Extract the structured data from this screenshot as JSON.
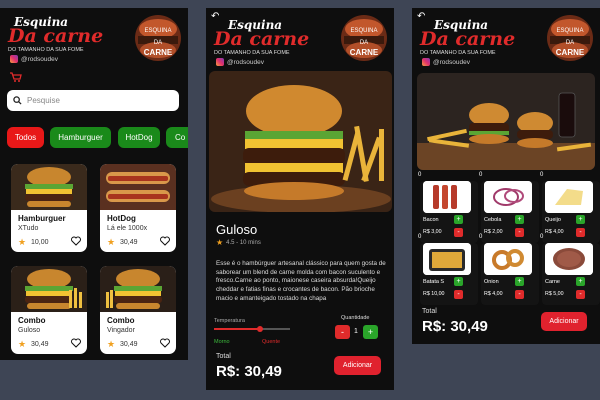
{
  "brand": {
    "top": "Esquina",
    "main": "Da carne",
    "tagline": "DO TAMANHO DA SUA FOME",
    "instagram": "@rodsoudev",
    "logo_line1": "ESQUINA",
    "logo_line2": "DA",
    "logo_line3": "CARNE"
  },
  "colors": {
    "accent": "#e0222e",
    "green": "#1e8a1e",
    "bg": "#0e0e0e"
  },
  "home": {
    "search_placeholder": "Pesquise",
    "categories": [
      "Todos",
      "Hamburguer",
      "HotDog",
      "Co"
    ],
    "products": [
      {
        "name": "Hamburguer",
        "sub": "XTudo",
        "price": "10,00"
      },
      {
        "name": "HotDog",
        "sub": "Lá ele 1000x",
        "price": "30,49"
      },
      {
        "name": "Combo",
        "sub": "Guloso",
        "price": "30,49"
      },
      {
        "name": "Combo",
        "sub": "Vingador",
        "price": "30,49"
      }
    ]
  },
  "detail": {
    "title": "Guloso",
    "rating": "4.5 - 10 mins",
    "description": "Esse é o hambúrguer artesanal clássico para quem gosta de saborear um blend de carne molda com bacon suculento e fresco.Carne ao ponto, maionese caseira absurda!Queijo cheddar e fatias finas e crocantes de bacon. Pão brioche macio e amanteigado tostado na chapa",
    "temp_label": "Temperatura",
    "temp_min": "Morno",
    "temp_max": "Quente",
    "temp_level": 0.6,
    "qty_label": "Quantidade",
    "qty_value": "1",
    "minus": "-",
    "plus": "+",
    "total_label": "Total",
    "total_value": "R$: 30,49",
    "add_label": "Adicionar"
  },
  "extras": {
    "ingredients": [
      {
        "count": "0",
        "name": "Bacon",
        "price": "R$ 3,00"
      },
      {
        "count": "0",
        "name": "Cebola",
        "price": "R$ 2,00"
      },
      {
        "count": "0",
        "name": "Queijo",
        "price": "R$ 4,00"
      },
      {
        "count": "0",
        "name": "Batata S",
        "price": "R$ 10,00"
      },
      {
        "count": "0",
        "name": "Onion",
        "price": "R$ 4,00"
      },
      {
        "count": "0",
        "name": "Carne",
        "price": "R$ 5,00"
      }
    ],
    "plus": "+",
    "minus": "-",
    "total_label": "Total",
    "total_value": "R$: 30,49",
    "add_label": "Adicionar"
  }
}
